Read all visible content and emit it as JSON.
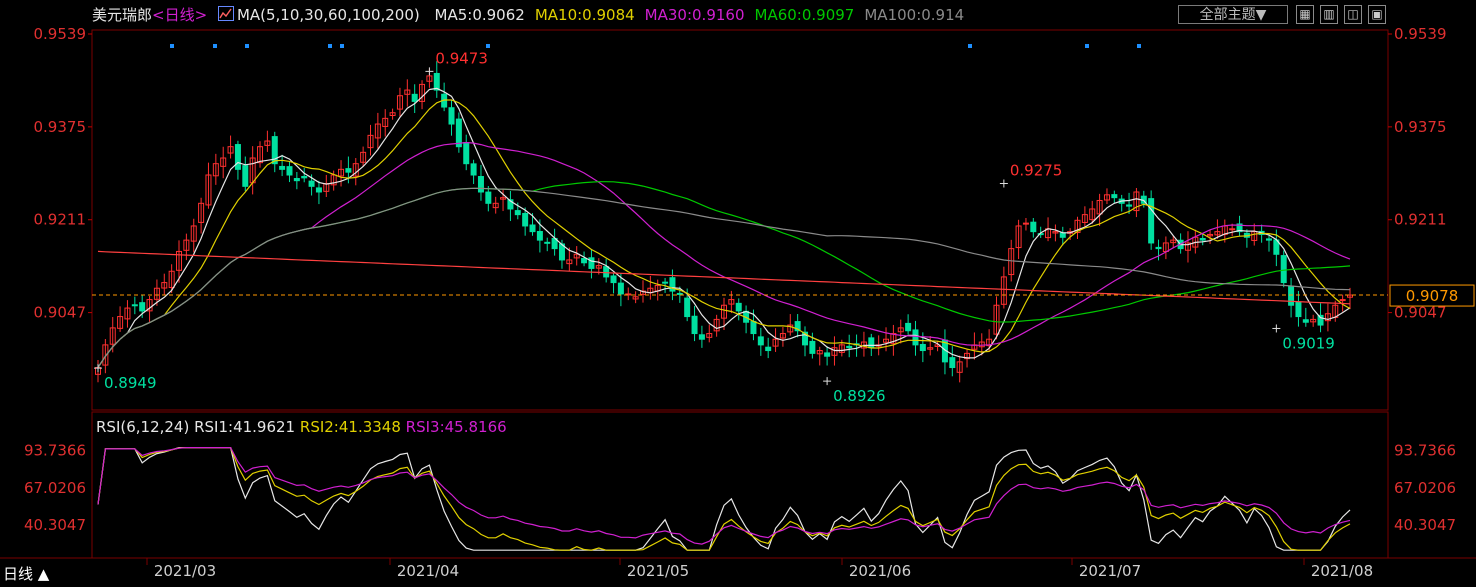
{
  "header": {
    "symbol": "美元瑞郎",
    "period_tag": "<日线>",
    "ma_label": "MA(5,10,30,60,100,200)",
    "ma_values": [
      {
        "text": "MA5:0.9062",
        "color": "#e6e6e6"
      },
      {
        "text": "MA10:0.9084",
        "color": "#e0d000"
      },
      {
        "text": "MA30:0.9160",
        "color": "#d020d0"
      },
      {
        "text": "MA60:0.9097",
        "color": "#00c800"
      },
      {
        "text": "MA100:0.914",
        "color": "#8a8a8a"
      }
    ],
    "theme_button": "全部主题▼",
    "icon_buttons": [
      "grid-icon",
      "panel-icon",
      "zoom-icon",
      "expand-icon"
    ]
  },
  "chart_data": [
    {
      "type": "candlestick",
      "title": "美元瑞郎 日线",
      "y_ticks": [
        0.9539,
        0.9375,
        0.9211,
        0.9047
      ],
      "ylim": [
        0.8875,
        0.9539
      ],
      "x_labels": [
        "2021/03",
        "2021/04",
        "2021/05",
        "2021/06",
        "2021/07",
        "2021/08"
      ],
      "last_price": "0.9078",
      "annotations": [
        {
          "text": "0.9473",
          "value": 0.9473,
          "kind": "high"
        },
        {
          "text": "0.8949",
          "value": 0.8949,
          "kind": "low"
        },
        {
          "text": "0.9275",
          "value": 0.9275,
          "kind": "high"
        },
        {
          "text": "0.8926",
          "value": 0.8926,
          "kind": "low"
        },
        {
          "text": "0.9019",
          "value": 0.9019,
          "kind": "low"
        }
      ],
      "close": [
        0.895,
        0.899,
        0.902,
        0.904,
        0.9055,
        0.906,
        0.905,
        0.907,
        0.909,
        0.91,
        0.912,
        0.9155,
        0.9175,
        0.92,
        0.924,
        0.929,
        0.931,
        0.932,
        0.934,
        0.93,
        0.927,
        0.932,
        0.934,
        0.935,
        0.931,
        0.93,
        0.929,
        0.928,
        0.9285,
        0.927,
        0.926,
        0.9275,
        0.929,
        0.93,
        0.9295,
        0.931,
        0.933,
        0.936,
        0.938,
        0.939,
        0.94,
        0.943,
        0.944,
        0.942,
        0.945,
        0.9465,
        0.944,
        0.941,
        0.938,
        0.934,
        0.931,
        0.929,
        0.926,
        0.924,
        0.924,
        0.925,
        0.923,
        0.922,
        0.92,
        0.919,
        0.9175,
        0.917,
        0.916,
        0.914,
        0.914,
        0.915,
        0.9135,
        0.9125,
        0.913,
        0.911,
        0.91,
        0.908,
        0.908,
        0.9075,
        0.9085,
        0.909,
        0.9095,
        0.91,
        0.9085,
        0.908,
        0.904,
        0.901,
        0.9,
        0.901,
        0.9035,
        0.906,
        0.907,
        0.905,
        0.903,
        0.901,
        0.899,
        0.898,
        0.9,
        0.901,
        0.9025,
        0.9015,
        0.899,
        0.8975,
        0.898,
        0.897,
        0.8985,
        0.899,
        0.8985,
        0.899,
        0.8995,
        0.8985,
        0.899,
        0.9,
        0.901,
        0.902,
        0.9015,
        0.899,
        0.898,
        0.8985,
        0.899,
        0.896,
        0.895,
        0.896,
        0.8975,
        0.899,
        0.8995,
        0.9,
        0.906,
        0.911,
        0.916,
        0.92,
        0.9205,
        0.919,
        0.9185,
        0.9195,
        0.919,
        0.918,
        0.919,
        0.921,
        0.922,
        0.923,
        0.9245,
        0.9255,
        0.925,
        0.924,
        0.9235,
        0.926,
        0.924,
        0.917,
        0.916,
        0.917,
        0.9175,
        0.916,
        0.917,
        0.918,
        0.9175,
        0.9185,
        0.919,
        0.92,
        0.9195,
        0.919,
        0.918,
        0.919,
        0.9185,
        0.9175,
        0.915,
        0.91,
        0.906,
        0.904,
        0.903,
        0.9035,
        0.9025,
        0.9045,
        0.906,
        0.907,
        0.9078
      ]
    },
    {
      "type": "line",
      "title": "RSI(6,12,24)",
      "y_ticks": [
        93.7366,
        67.0206,
        40.3047
      ],
      "ylim": [
        20,
        100
      ],
      "series": [
        {
          "name": "RSI1",
          "label": "RSI1:41.9621",
          "color": "#e6e6e6"
        },
        {
          "name": "RSI2",
          "label": "RSI2:41.3348",
          "color": "#e0d000"
        },
        {
          "name": "RSI3",
          "label": "RSI3:45.8166",
          "color": "#d020d0"
        }
      ]
    }
  ],
  "period_tab": "日线 ▲"
}
